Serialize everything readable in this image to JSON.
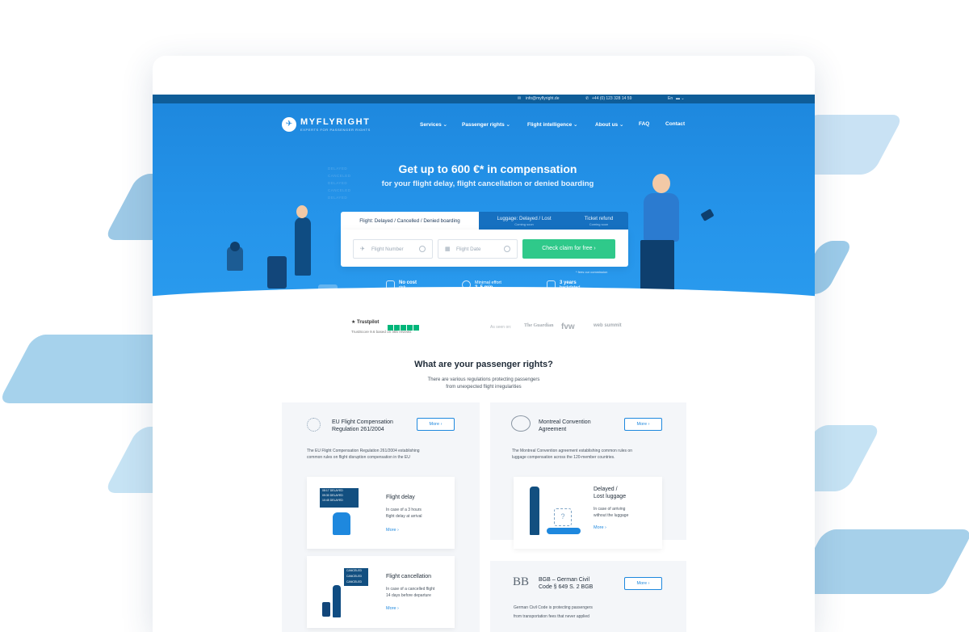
{
  "topbar": {
    "email": "info@myflyright.de",
    "phone": "+44 (0) 123 328 14 59",
    "lang": "En"
  },
  "header": {
    "logo_mark": "✈",
    "logo_text": "MYFLYRIGHT",
    "logo_tagline": "EXPERTS FOR PASSENGER RIGHTS",
    "nav": [
      "Services ⌄",
      "Passenger rights ⌄",
      "Flight intelligence ⌄",
      "About us ⌄",
      "FAQ",
      "Contact"
    ]
  },
  "hero": {
    "title": "Get up to 600 €* in compensation",
    "subtitle": "for your flight delay, flight cancellation or denied boarding",
    "board_words": [
      "DELAYED",
      "CANCELED",
      "DELAYED",
      "CANCELED",
      "DELAYED"
    ]
  },
  "form": {
    "tabs": [
      {
        "label": "Flight: Delayed / Cancelled / Denied boarding",
        "note": ""
      },
      {
        "label": "Luggage: Delayed / Lost",
        "note": "Coming soon"
      },
      {
        "label": "Ticket refund",
        "note": "Coming soon"
      }
    ],
    "flight_number_placeholder": "Flight Number",
    "flight_date_placeholder": "Flight Date",
    "submit_label": "Check claim for free  ›",
    "fee_note": "* fees our commission"
  },
  "features": [
    {
      "title": "No cost",
      "text": "risk"
    },
    {
      "title": "Minimal effort",
      "text": "3–5 min"
    },
    {
      "title": "3 years",
      "text": "backdated"
    }
  ],
  "trust": {
    "brand": "★ Trustpilot",
    "score_text": "TrustScore 9.6 based on 465 reviews",
    "seen_label": "As seen on:",
    "press": [
      "The Guardian",
      "fvw",
      "web summit"
    ]
  },
  "rights": {
    "title": "What are your passenger rights?",
    "subtitle_line1": "There are various regulations protecting passengers",
    "subtitle_line2": "from unexpected flight irregularities"
  },
  "panels": [
    {
      "title_line1": "EU Flight Compensation",
      "title_line2": "Regulation 261/2004",
      "more": "More  ›",
      "desc_line1": "The EU Flight Compensation Regulation 261/2004 establishing",
      "desc_line2": "common rules on flight disruption compensation in the EU",
      "cards": [
        {
          "title": "Flight delay",
          "desc_line1": "In case of a 3 hours",
          "desc_line2": "flight delay at arrival",
          "more": "More  ›",
          "board": [
            "08:17  DELAYED",
            "09:30  DELAYED",
            "10:45  DELAYED"
          ]
        },
        {
          "title": "Flight cancellation",
          "desc_line1": "In case of a cancelled flight",
          "desc_line2": "14 days before departure",
          "more": "More  ›",
          "board": [
            "CANCELED",
            "CANCELED",
            "CANCELED"
          ]
        }
      ]
    },
    {
      "title_line1": "Montreal Convention",
      "title_line2": "Agreement",
      "more": "More  ›",
      "desc_line1": "The Montreal Convention agreement establishing common rules on",
      "desc_line2": "luggage compensation across the 120-member countries.",
      "cards": [
        {
          "title_line1": "Delayed /",
          "title_line2": "Lost luggage",
          "desc_line1": "In case of arriving",
          "desc_line2": "without the luggage",
          "more": "More  ›"
        }
      ]
    },
    {
      "icon_text": "BB",
      "title_line1": "BGB – German Civil",
      "title_line2": "Code § 649 S. 2 BGB",
      "more": "More  ›",
      "desc_line1": "German Civil Code is protecting passengers",
      "desc_line2": "from transportation fees that never applied"
    }
  ],
  "colors": {
    "hero_blue": "#1e88de",
    "topbar_navy": "#0f5d98",
    "cta_green": "#2fc98a",
    "trustpilot_green": "#00b67a"
  }
}
